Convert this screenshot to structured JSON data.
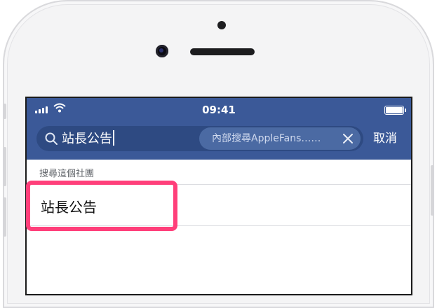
{
  "status_bar": {
    "time": "09:41",
    "signal_icon": "cellular-signal-icon",
    "wifi_icon": "wifi-icon",
    "battery_icon": "battery-icon"
  },
  "search": {
    "query": "站長公告",
    "scope_label": "內部搜尋AppleFans……",
    "search_icon": "search-icon",
    "clear_icon": "close-icon",
    "cancel_label": "取消"
  },
  "results": {
    "section_title": "搜尋這個社團",
    "items": [
      {
        "label": "站長公告"
      }
    ]
  },
  "colors": {
    "nav_bar": "#3b5998",
    "highlight": "#ff3f7a"
  }
}
